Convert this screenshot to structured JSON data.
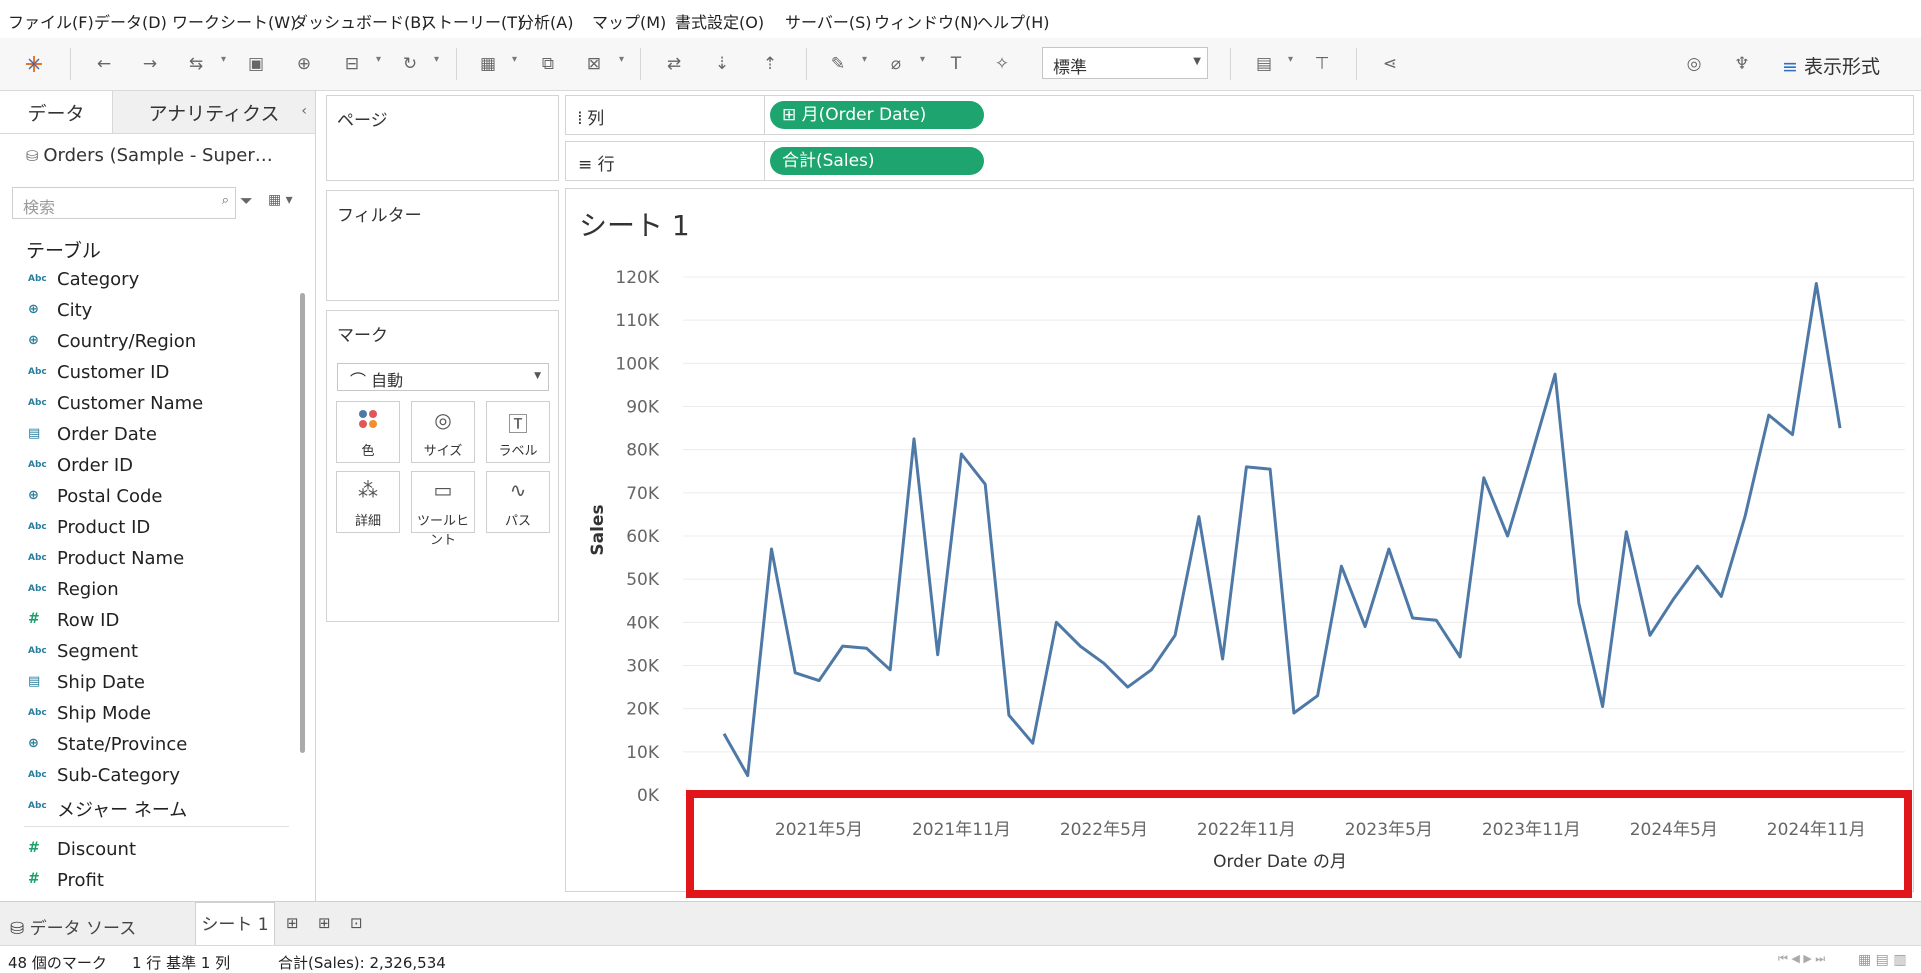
{
  "menu": [
    "ファイル(F)",
    "データ(D)",
    "ワークシート(W)",
    "ダッシュボード(B)",
    "ストーリー(T)",
    "分析(A)",
    "マップ(M)",
    "書式設定(O)",
    "サーバー(S)",
    "ウィンドウ(N)",
    "ヘルプ(H)"
  ],
  "toolbar": {
    "fit_value": "標準",
    "show_me": "表示形式"
  },
  "datapane": {
    "tab_data": "データ",
    "tab_analytics": "アナリティクス",
    "datasource": "Orders (Sample - Super…",
    "search_placeholder": "検索",
    "tables_header": "テーブル",
    "fields": [
      {
        "type": "Abc",
        "label": "Category"
      },
      {
        "type": "globe",
        "label": "City"
      },
      {
        "type": "globe",
        "label": "Country/Region"
      },
      {
        "type": "Abc",
        "label": "Customer ID"
      },
      {
        "type": "Abc",
        "label": "Customer Name"
      },
      {
        "type": "date",
        "label": "Order Date"
      },
      {
        "type": "Abc",
        "label": "Order ID"
      },
      {
        "type": "globe",
        "label": "Postal Code"
      },
      {
        "type": "Abc",
        "label": "Product ID"
      },
      {
        "type": "Abc",
        "label": "Product Name"
      },
      {
        "type": "Abc",
        "label": "Region"
      },
      {
        "type": "#",
        "label": "Row ID"
      },
      {
        "type": "Abc",
        "label": "Segment"
      },
      {
        "type": "date",
        "label": "Ship Date"
      },
      {
        "type": "Abc",
        "label": "Ship Mode"
      },
      {
        "type": "globe",
        "label": "State/Province"
      },
      {
        "type": "Abc",
        "label": "Sub-Category"
      },
      {
        "type": "Abc",
        "label": "メジャー ネーム"
      },
      {
        "type": "#",
        "label": "Discount"
      },
      {
        "type": "#",
        "label": "Profit"
      }
    ]
  },
  "cards": {
    "pages": "ページ",
    "filters": "フィルター",
    "marks": "マーク",
    "marks_type": "自動",
    "mark_buttons": [
      "色",
      "サイズ",
      "ラベル",
      "詳細",
      "ツールヒント",
      "パス"
    ]
  },
  "shelves": {
    "columns_label": "列",
    "columns_pill": "月(Order Date)",
    "rows_label": "行",
    "rows_pill": "合計(Sales)"
  },
  "sheet": {
    "title": "シート 1"
  },
  "chart_data": {
    "type": "line",
    "title": "シート 1",
    "xlabel": "Order Date の月",
    "ylabel": "Sales",
    "ylim": [
      0,
      120000
    ],
    "yticks": [
      "0K",
      "10K",
      "20K",
      "30K",
      "40K",
      "50K",
      "60K",
      "70K",
      "80K",
      "90K",
      "100K",
      "110K",
      "120K"
    ],
    "xticks": [
      "2021年5月",
      "2021年11月",
      "2022年5月",
      "2022年11月",
      "2023年5月",
      "2023年11月",
      "2024年5月",
      "2024年11月"
    ],
    "xtick_month_index": [
      4,
      10,
      16,
      22,
      28,
      34,
      40,
      46
    ],
    "color": "#4e79a7",
    "series": [
      {
        "values": [
          14200,
          4500,
          57000,
          28300,
          26500,
          34500,
          34000,
          29000,
          82500,
          32500,
          79000,
          72000,
          18500,
          12000,
          40000,
          34500,
          30500,
          25000,
          29000,
          37000,
          64500,
          31500,
          76000,
          75500,
          19000,
          23000,
          53000,
          39000,
          57000,
          41000,
          40500,
          32000,
          73500,
          60000,
          78500,
          97500,
          44500,
          20500,
          61000,
          37000,
          45500,
          53000,
          46000,
          64500,
          88000,
          83500,
          118500,
          85000
        ]
      }
    ]
  },
  "sheetbar": {
    "datasource_tab": "データ ソース",
    "sheet_tab": "シート 1"
  },
  "status": {
    "marks": "48 個のマーク",
    "layout": "1 行 基準 1 列",
    "sum": "合計(Sales): 2,326,534"
  }
}
